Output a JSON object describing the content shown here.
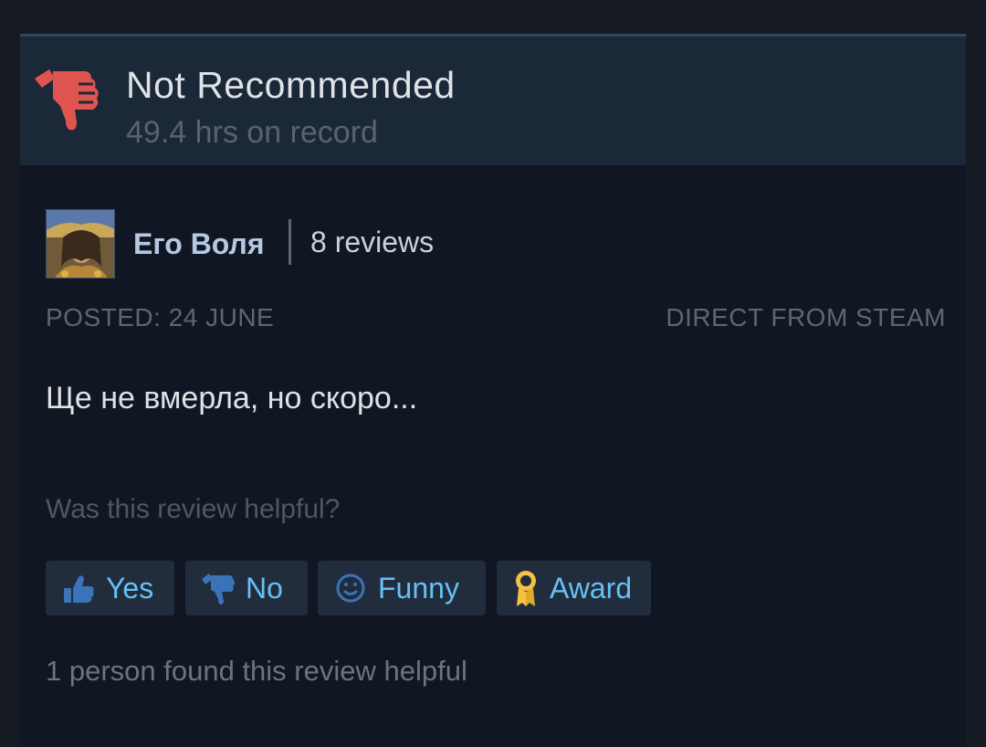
{
  "review": {
    "verdict": "Not Recommended",
    "hours": "49.4 hrs on record",
    "verdict_icon": "thumbs-down-icon",
    "verdict_color": "#e0544f"
  },
  "author": {
    "name": "Его Воля",
    "review_count": "8 reviews"
  },
  "meta": {
    "posted": "POSTED: 24 JUNE",
    "source": "DIRECT FROM STEAM"
  },
  "body": {
    "text": "Ще не вмерла, но скоро..."
  },
  "feedback": {
    "question": "Was this review helpful?",
    "buttons": [
      {
        "label": "Yes",
        "icon": "thumbs-up-icon"
      },
      {
        "label": "No",
        "icon": "thumbs-down-icon"
      },
      {
        "label": "Funny",
        "icon": "smiley-icon"
      },
      {
        "label": "Award",
        "icon": "award-icon"
      }
    ],
    "helpful_count": "1 person found this review helpful"
  },
  "colors": {
    "page_bg": "#161a22",
    "card_bg": "#111722",
    "header_bg": "#1b2838",
    "button_bg": "#212d3d",
    "link_blue": "#66c0f4",
    "award_gold": "#f5c242"
  }
}
